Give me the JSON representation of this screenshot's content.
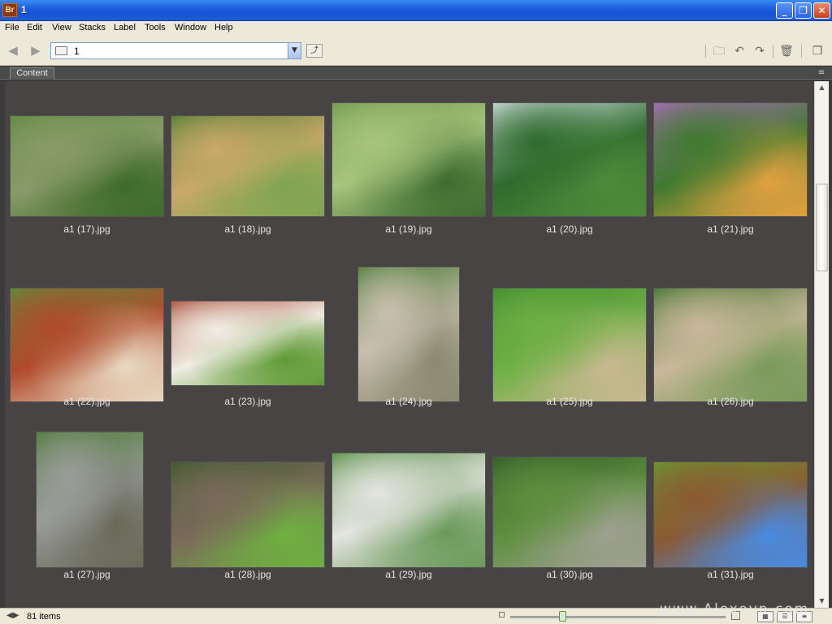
{
  "window": {
    "app_badge": "Br",
    "title": "1",
    "min_glyph": "_",
    "max_glyph": "❐",
    "close_glyph": "✕"
  },
  "menu": [
    "File",
    "Edit",
    "View",
    "Stacks",
    "Label",
    "Tools",
    "Window",
    "Help"
  ],
  "pathbar": {
    "back_glyph": "◀",
    "forward_glyph": "▶",
    "path": "1",
    "dropdown_glyph": "▼",
    "up_glyph": "⤴"
  },
  "toolbar_icons": [
    "new-folder-icon",
    "rotate-left-icon",
    "rotate-right-icon",
    "trash-icon",
    "compact-mode-icon"
  ],
  "toolbar_glyphs": [
    "🗀",
    "↶",
    "↷",
    "🗑",
    "❐"
  ],
  "content": {
    "tab_label": "Content",
    "panel_menu_glyph": "≡"
  },
  "thumbnails": [
    {
      "label": "a1 (17).jpg",
      "colors": [
        "#5f8c3e",
        "#8a9a6a",
        "#3d6b2a"
      ]
    },
    {
      "label": "a1 (18).jpg",
      "colors": [
        "#4f7d2f",
        "#c9a86a",
        "#7fa552"
      ]
    },
    {
      "label": "a1 (19).jpg",
      "colors": [
        "#6f9a4a",
        "#a7c47c",
        "#3e6d30"
      ]
    },
    {
      "label": "a1 (20).jpg",
      "colors": [
        "#d8e4e8",
        "#2f6b2d",
        "#4d8a3a"
      ]
    },
    {
      "label": "a1 (21).jpg",
      "colors": [
        "#b36bc4",
        "#3f7a2f",
        "#e0a040"
      ]
    },
    {
      "label": "a1 (22).jpg",
      "colors": [
        "#5a8f3a",
        "#b04a2a",
        "#e8d8c0"
      ]
    },
    {
      "label": "a1 (23).jpg",
      "colors": [
        "#a7452f",
        "#f0ede4",
        "#5f9a34"
      ]
    },
    {
      "label": "a1 (24).jpg",
      "colors": [
        "#4d7a35",
        "#c8bfae",
        "#8a8a70"
      ]
    },
    {
      "label": "a1 (25).jpg",
      "colors": [
        "#3f8a2e",
        "#6fb044",
        "#c8b890"
      ]
    },
    {
      "label": "a1 (26).jpg",
      "colors": [
        "#3d6f2c",
        "#c9b89a",
        "#7a9a5a"
      ]
    },
    {
      "label": "a1 (27).jpg",
      "colors": [
        "#4a7a32",
        "#9a9c9a",
        "#6a6a5a"
      ]
    },
    {
      "label": "a1 (28).jpg",
      "colors": [
        "#3a5a2a",
        "#7a6a5a",
        "#6fb040"
      ]
    },
    {
      "label": "a1 (29).jpg",
      "colors": [
        "#4d8a3a",
        "#e4e4e0",
        "#6a9a5a"
      ]
    },
    {
      "label": "a1 (30).jpg",
      "colors": [
        "#2f5a26",
        "#5f8f3f",
        "#9ea090"
      ]
    },
    {
      "label": "a1 (31).jpg",
      "colors": [
        "#6a9a32",
        "#8a5a32",
        "#4a8ae0"
      ]
    }
  ],
  "status": {
    "toggle_glyph": "◀▶",
    "item_count": "81 items",
    "zoom_level": 0.24,
    "view_buttons": [
      "▦",
      "☰",
      "≡"
    ]
  },
  "watermark": "www.Aloxovn.com"
}
